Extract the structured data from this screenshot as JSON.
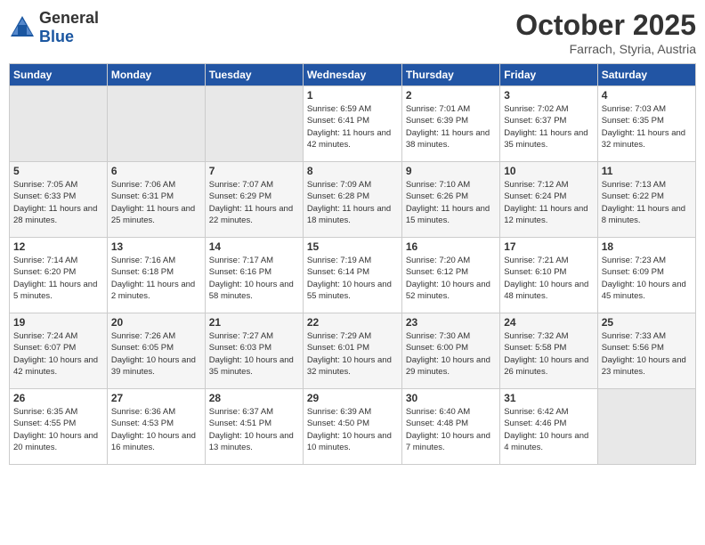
{
  "header": {
    "logo_general": "General",
    "logo_blue": "Blue",
    "month_title": "October 2025",
    "location": "Farrach, Styria, Austria"
  },
  "weekdays": [
    "Sunday",
    "Monday",
    "Tuesday",
    "Wednesday",
    "Thursday",
    "Friday",
    "Saturday"
  ],
  "weeks": [
    [
      {
        "day": "",
        "info": ""
      },
      {
        "day": "",
        "info": ""
      },
      {
        "day": "",
        "info": ""
      },
      {
        "day": "1",
        "info": "Sunrise: 6:59 AM\nSunset: 6:41 PM\nDaylight: 11 hours and 42 minutes."
      },
      {
        "day": "2",
        "info": "Sunrise: 7:01 AM\nSunset: 6:39 PM\nDaylight: 11 hours and 38 minutes."
      },
      {
        "day": "3",
        "info": "Sunrise: 7:02 AM\nSunset: 6:37 PM\nDaylight: 11 hours and 35 minutes."
      },
      {
        "day": "4",
        "info": "Sunrise: 7:03 AM\nSunset: 6:35 PM\nDaylight: 11 hours and 32 minutes."
      }
    ],
    [
      {
        "day": "5",
        "info": "Sunrise: 7:05 AM\nSunset: 6:33 PM\nDaylight: 11 hours and 28 minutes."
      },
      {
        "day": "6",
        "info": "Sunrise: 7:06 AM\nSunset: 6:31 PM\nDaylight: 11 hours and 25 minutes."
      },
      {
        "day": "7",
        "info": "Sunrise: 7:07 AM\nSunset: 6:29 PM\nDaylight: 11 hours and 22 minutes."
      },
      {
        "day": "8",
        "info": "Sunrise: 7:09 AM\nSunset: 6:28 PM\nDaylight: 11 hours and 18 minutes."
      },
      {
        "day": "9",
        "info": "Sunrise: 7:10 AM\nSunset: 6:26 PM\nDaylight: 11 hours and 15 minutes."
      },
      {
        "day": "10",
        "info": "Sunrise: 7:12 AM\nSunset: 6:24 PM\nDaylight: 11 hours and 12 minutes."
      },
      {
        "day": "11",
        "info": "Sunrise: 7:13 AM\nSunset: 6:22 PM\nDaylight: 11 hours and 8 minutes."
      }
    ],
    [
      {
        "day": "12",
        "info": "Sunrise: 7:14 AM\nSunset: 6:20 PM\nDaylight: 11 hours and 5 minutes."
      },
      {
        "day": "13",
        "info": "Sunrise: 7:16 AM\nSunset: 6:18 PM\nDaylight: 11 hours and 2 minutes."
      },
      {
        "day": "14",
        "info": "Sunrise: 7:17 AM\nSunset: 6:16 PM\nDaylight: 10 hours and 58 minutes."
      },
      {
        "day": "15",
        "info": "Sunrise: 7:19 AM\nSunset: 6:14 PM\nDaylight: 10 hours and 55 minutes."
      },
      {
        "day": "16",
        "info": "Sunrise: 7:20 AM\nSunset: 6:12 PM\nDaylight: 10 hours and 52 minutes."
      },
      {
        "day": "17",
        "info": "Sunrise: 7:21 AM\nSunset: 6:10 PM\nDaylight: 10 hours and 48 minutes."
      },
      {
        "day": "18",
        "info": "Sunrise: 7:23 AM\nSunset: 6:09 PM\nDaylight: 10 hours and 45 minutes."
      }
    ],
    [
      {
        "day": "19",
        "info": "Sunrise: 7:24 AM\nSunset: 6:07 PM\nDaylight: 10 hours and 42 minutes."
      },
      {
        "day": "20",
        "info": "Sunrise: 7:26 AM\nSunset: 6:05 PM\nDaylight: 10 hours and 39 minutes."
      },
      {
        "day": "21",
        "info": "Sunrise: 7:27 AM\nSunset: 6:03 PM\nDaylight: 10 hours and 35 minutes."
      },
      {
        "day": "22",
        "info": "Sunrise: 7:29 AM\nSunset: 6:01 PM\nDaylight: 10 hours and 32 minutes."
      },
      {
        "day": "23",
        "info": "Sunrise: 7:30 AM\nSunset: 6:00 PM\nDaylight: 10 hours and 29 minutes."
      },
      {
        "day": "24",
        "info": "Sunrise: 7:32 AM\nSunset: 5:58 PM\nDaylight: 10 hours and 26 minutes."
      },
      {
        "day": "25",
        "info": "Sunrise: 7:33 AM\nSunset: 5:56 PM\nDaylight: 10 hours and 23 minutes."
      }
    ],
    [
      {
        "day": "26",
        "info": "Sunrise: 6:35 AM\nSunset: 4:55 PM\nDaylight: 10 hours and 20 minutes."
      },
      {
        "day": "27",
        "info": "Sunrise: 6:36 AM\nSunset: 4:53 PM\nDaylight: 10 hours and 16 minutes."
      },
      {
        "day": "28",
        "info": "Sunrise: 6:37 AM\nSunset: 4:51 PM\nDaylight: 10 hours and 13 minutes."
      },
      {
        "day": "29",
        "info": "Sunrise: 6:39 AM\nSunset: 4:50 PM\nDaylight: 10 hours and 10 minutes."
      },
      {
        "day": "30",
        "info": "Sunrise: 6:40 AM\nSunset: 4:48 PM\nDaylight: 10 hours and 7 minutes."
      },
      {
        "day": "31",
        "info": "Sunrise: 6:42 AM\nSunset: 4:46 PM\nDaylight: 10 hours and 4 minutes."
      },
      {
        "day": "",
        "info": ""
      }
    ]
  ]
}
